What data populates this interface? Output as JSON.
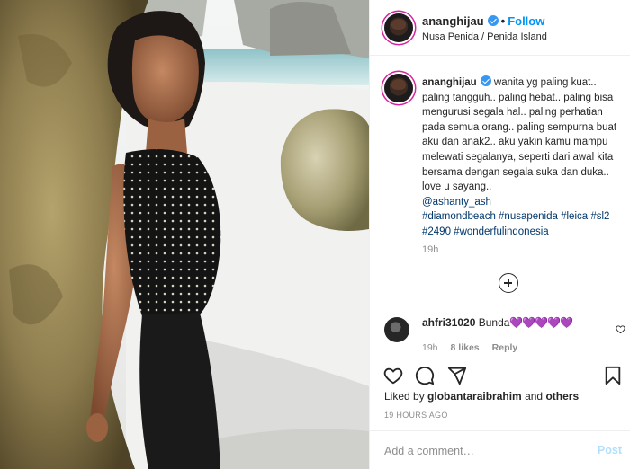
{
  "post": {
    "username": "ananghijau",
    "follow_label": "Follow",
    "dot": "•",
    "location": "Nusa Penida / Penida Island",
    "photo_alt": "woman leaning against rock on beach"
  },
  "caption": {
    "username": "ananghijau",
    "text": "wanita yg paling kuat.. paling tangguh.. paling hebat.. paling bisa mengurusi segala hal.. paling perhatian pada semua orang.. paling sempurna buat aku dan anak2.. aku yakin kamu mampu melewati segalanya, seperti dari awal kita bersama dengan segala suka dan duka.. love u sayang..",
    "mention": "@ashanty_ash",
    "hashtags": "#diamondbeach #nusapenida #leica #sl2 #2490 #wonderfulindonesia",
    "time": "19h"
  },
  "comment": {
    "username": "ahfri31020",
    "text": "Bunda",
    "emoji": "💜💜💜💜💜",
    "time": "19h",
    "likes": "8 likes",
    "reply": "Reply"
  },
  "footer": {
    "liked_prefix": "Liked by",
    "liked_user": "globantaraibrahim",
    "liked_and": "and",
    "liked_others": "others",
    "ago": "19 HOURS AGO",
    "comment_placeholder": "Add a comment…",
    "post_label": "Post"
  },
  "colors": {
    "accent": "#0095f6",
    "verified": "#3897f0",
    "heart_emoji": "#a855f7"
  },
  "icons": [
    "verified-badge-icon",
    "plus-circle-icon",
    "heart-icon",
    "comment-icon",
    "share-icon",
    "bookmark-icon"
  ]
}
